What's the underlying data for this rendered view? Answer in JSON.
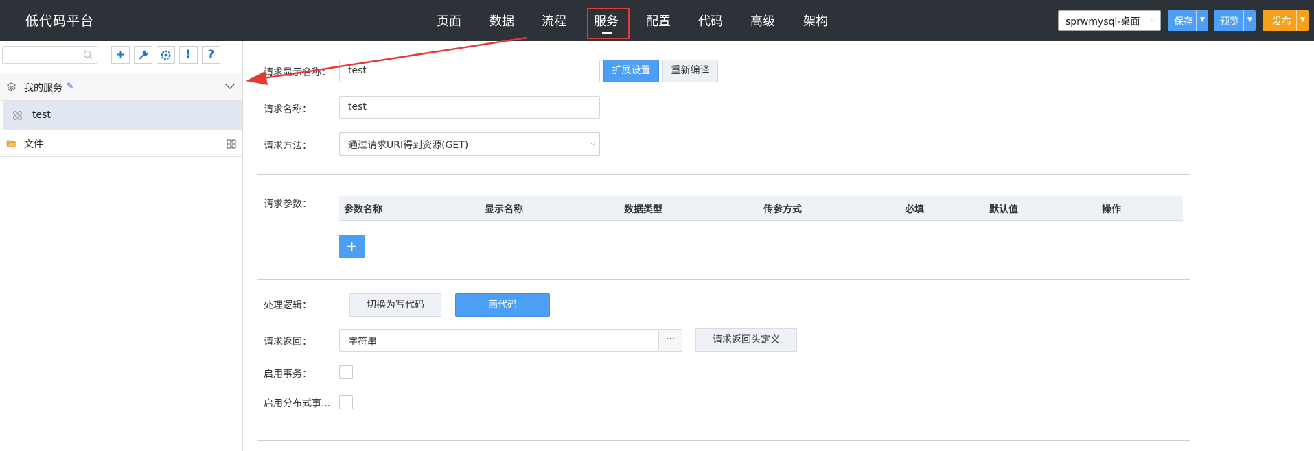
{
  "app": {
    "title": "低代码平台"
  },
  "nav": {
    "items": [
      "页面",
      "数据",
      "流程",
      "服务",
      "配置",
      "代码",
      "高级",
      "架构"
    ],
    "active": "服务"
  },
  "header": {
    "project_select": "sprwmysql-桌面",
    "save_label": "保存",
    "preview_label": "预览",
    "publish_label": "发布"
  },
  "sidebar": {
    "search_placeholder": "",
    "tools": [
      "+",
      "wrench-icon",
      "gear-icon",
      "!",
      "?"
    ],
    "group_label": "我的服务",
    "item_label": "test",
    "file_label": "文件"
  },
  "form": {
    "display_name_label": "请求显示名称：",
    "display_name_value": "test",
    "extend_settings_label": "扩展设置",
    "recompile_label": "重新编译",
    "name_label": "请求名称：",
    "name_value": "test",
    "method_label": "请求方法：",
    "method_value": "通过请求URI得到资源(GET)",
    "params_label": "请求参数：",
    "params_columns": [
      "参数名称",
      "显示名称",
      "数据类型",
      "传参方式",
      "必填",
      "默认值",
      "操作"
    ],
    "logic_label": "处理逻辑：",
    "switch_code_label": "切换为写代码",
    "draw_code_label": "画代码",
    "return_label": "请求返回：",
    "return_value": "字符串",
    "ellipsis_label": "···",
    "return_header_label": "请求返回头定义",
    "transaction_label": "启用事务：",
    "distributed_label": "启用分布式事..."
  },
  "colors": {
    "topbar": "#2d3238",
    "primary": "#4d9ff5",
    "publish": "#f7a01b",
    "highlight": "#e53935"
  }
}
